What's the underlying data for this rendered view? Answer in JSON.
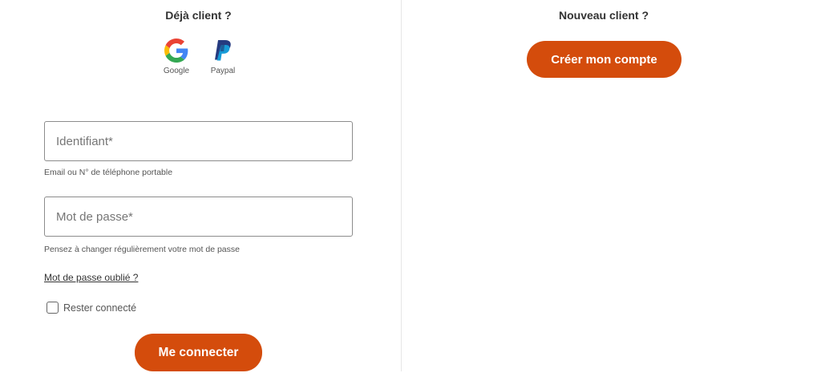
{
  "login": {
    "title": "Déjà client ?",
    "social": [
      {
        "label": "Google",
        "icon": "google-icon"
      },
      {
        "label": "Paypal",
        "icon": "paypal-icon"
      }
    ],
    "identifier": {
      "placeholder": "Identifiant*",
      "value": "",
      "hint": "Email ou N° de téléphone portable"
    },
    "password": {
      "placeholder": "Mot de passe*",
      "value": "",
      "hint": "Pensez à changer régulièrement votre mot de passe"
    },
    "forgot_link": "Mot de passe oublié ?",
    "remember_me": {
      "label": "Rester connecté",
      "checked": false
    },
    "submit_label": "Me connecter"
  },
  "signup": {
    "title": "Nouveau client ?",
    "create_label": "Créer mon compte"
  },
  "colors": {
    "accent": "#d44c0c",
    "text": "#333333",
    "border": "#8c8c8c"
  }
}
